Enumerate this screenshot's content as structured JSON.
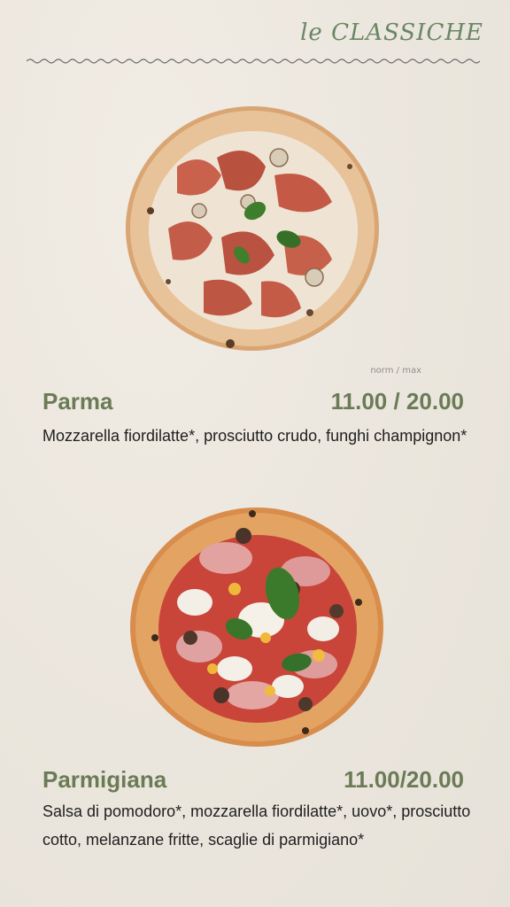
{
  "header": {
    "title": "le CLASSICHE"
  },
  "sizes_note": "norm / max",
  "products": [
    {
      "name": "Parma",
      "price": "11.00 / 20.00",
      "description": "Mozzarella fiordilatte*, prosciutto crudo, funghi champignon*"
    },
    {
      "name": "Parmigiana",
      "price": "11.00/20.00",
      "description": "Salsa di pomodoro*, mozzarella fiordilatte*, uovo*, prosciutto cotto, melanzane fritte, scaglie di parmigiano*"
    }
  ],
  "colors": {
    "accent": "#6b7b56",
    "background": "#ece7de"
  }
}
